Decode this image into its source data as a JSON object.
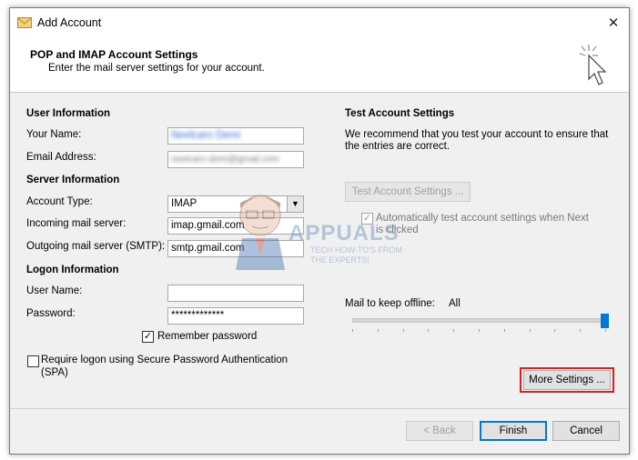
{
  "window": {
    "title": "Add Account",
    "close_glyph": "✕"
  },
  "header": {
    "title": "POP and IMAP Account Settings",
    "subtitle": "Enter the mail server settings for your account."
  },
  "user_info": {
    "heading": "User Information",
    "name_label": "Your Name:",
    "name_value": "Neelcaro Demi",
    "email_label": "Email Address:",
    "email_value": "neelcaro.demi@gmail.com"
  },
  "server_info": {
    "heading": "Server Information",
    "account_type_label": "Account Type:",
    "account_type_value": "IMAP",
    "incoming_label": "Incoming mail server:",
    "incoming_value": "imap.gmail.com",
    "outgoing_label": "Outgoing mail server (SMTP):",
    "outgoing_value": "smtp.gmail.com"
  },
  "logon_info": {
    "heading": "Logon Information",
    "username_label": "User Name:",
    "username_value": "",
    "password_label": "Password:",
    "password_value": "*************",
    "remember_label": "Remember password",
    "remember_checked": true,
    "spa_label_1": "Require logon using Secure Password Authentication",
    "spa_label_2": "(SPA)",
    "spa_checked": false
  },
  "test_settings": {
    "heading": "Test Account Settings",
    "desc_1": "We recommend that you test your account to ensure that",
    "desc_2": "the entries are correct.",
    "test_button": "Test Account Settings ...",
    "auto_test_1": "Automatically test account settings when Next",
    "auto_test_2": "is clicked",
    "auto_test_checked": true
  },
  "offline": {
    "label": "Mail to keep offline:",
    "value": "All",
    "slider_fraction": 1.0
  },
  "buttons": {
    "more_settings": "More Settings ...",
    "back": "< Back",
    "finish": "Finish",
    "cancel": "Cancel"
  },
  "watermark": {
    "brand": "APPUALS",
    "tagline_1": "TECH HOW-TO'S FROM",
    "tagline_2": "THE EXPERTS!"
  },
  "colors": {
    "accent": "#0078d7",
    "highlight": "#d9201c"
  }
}
